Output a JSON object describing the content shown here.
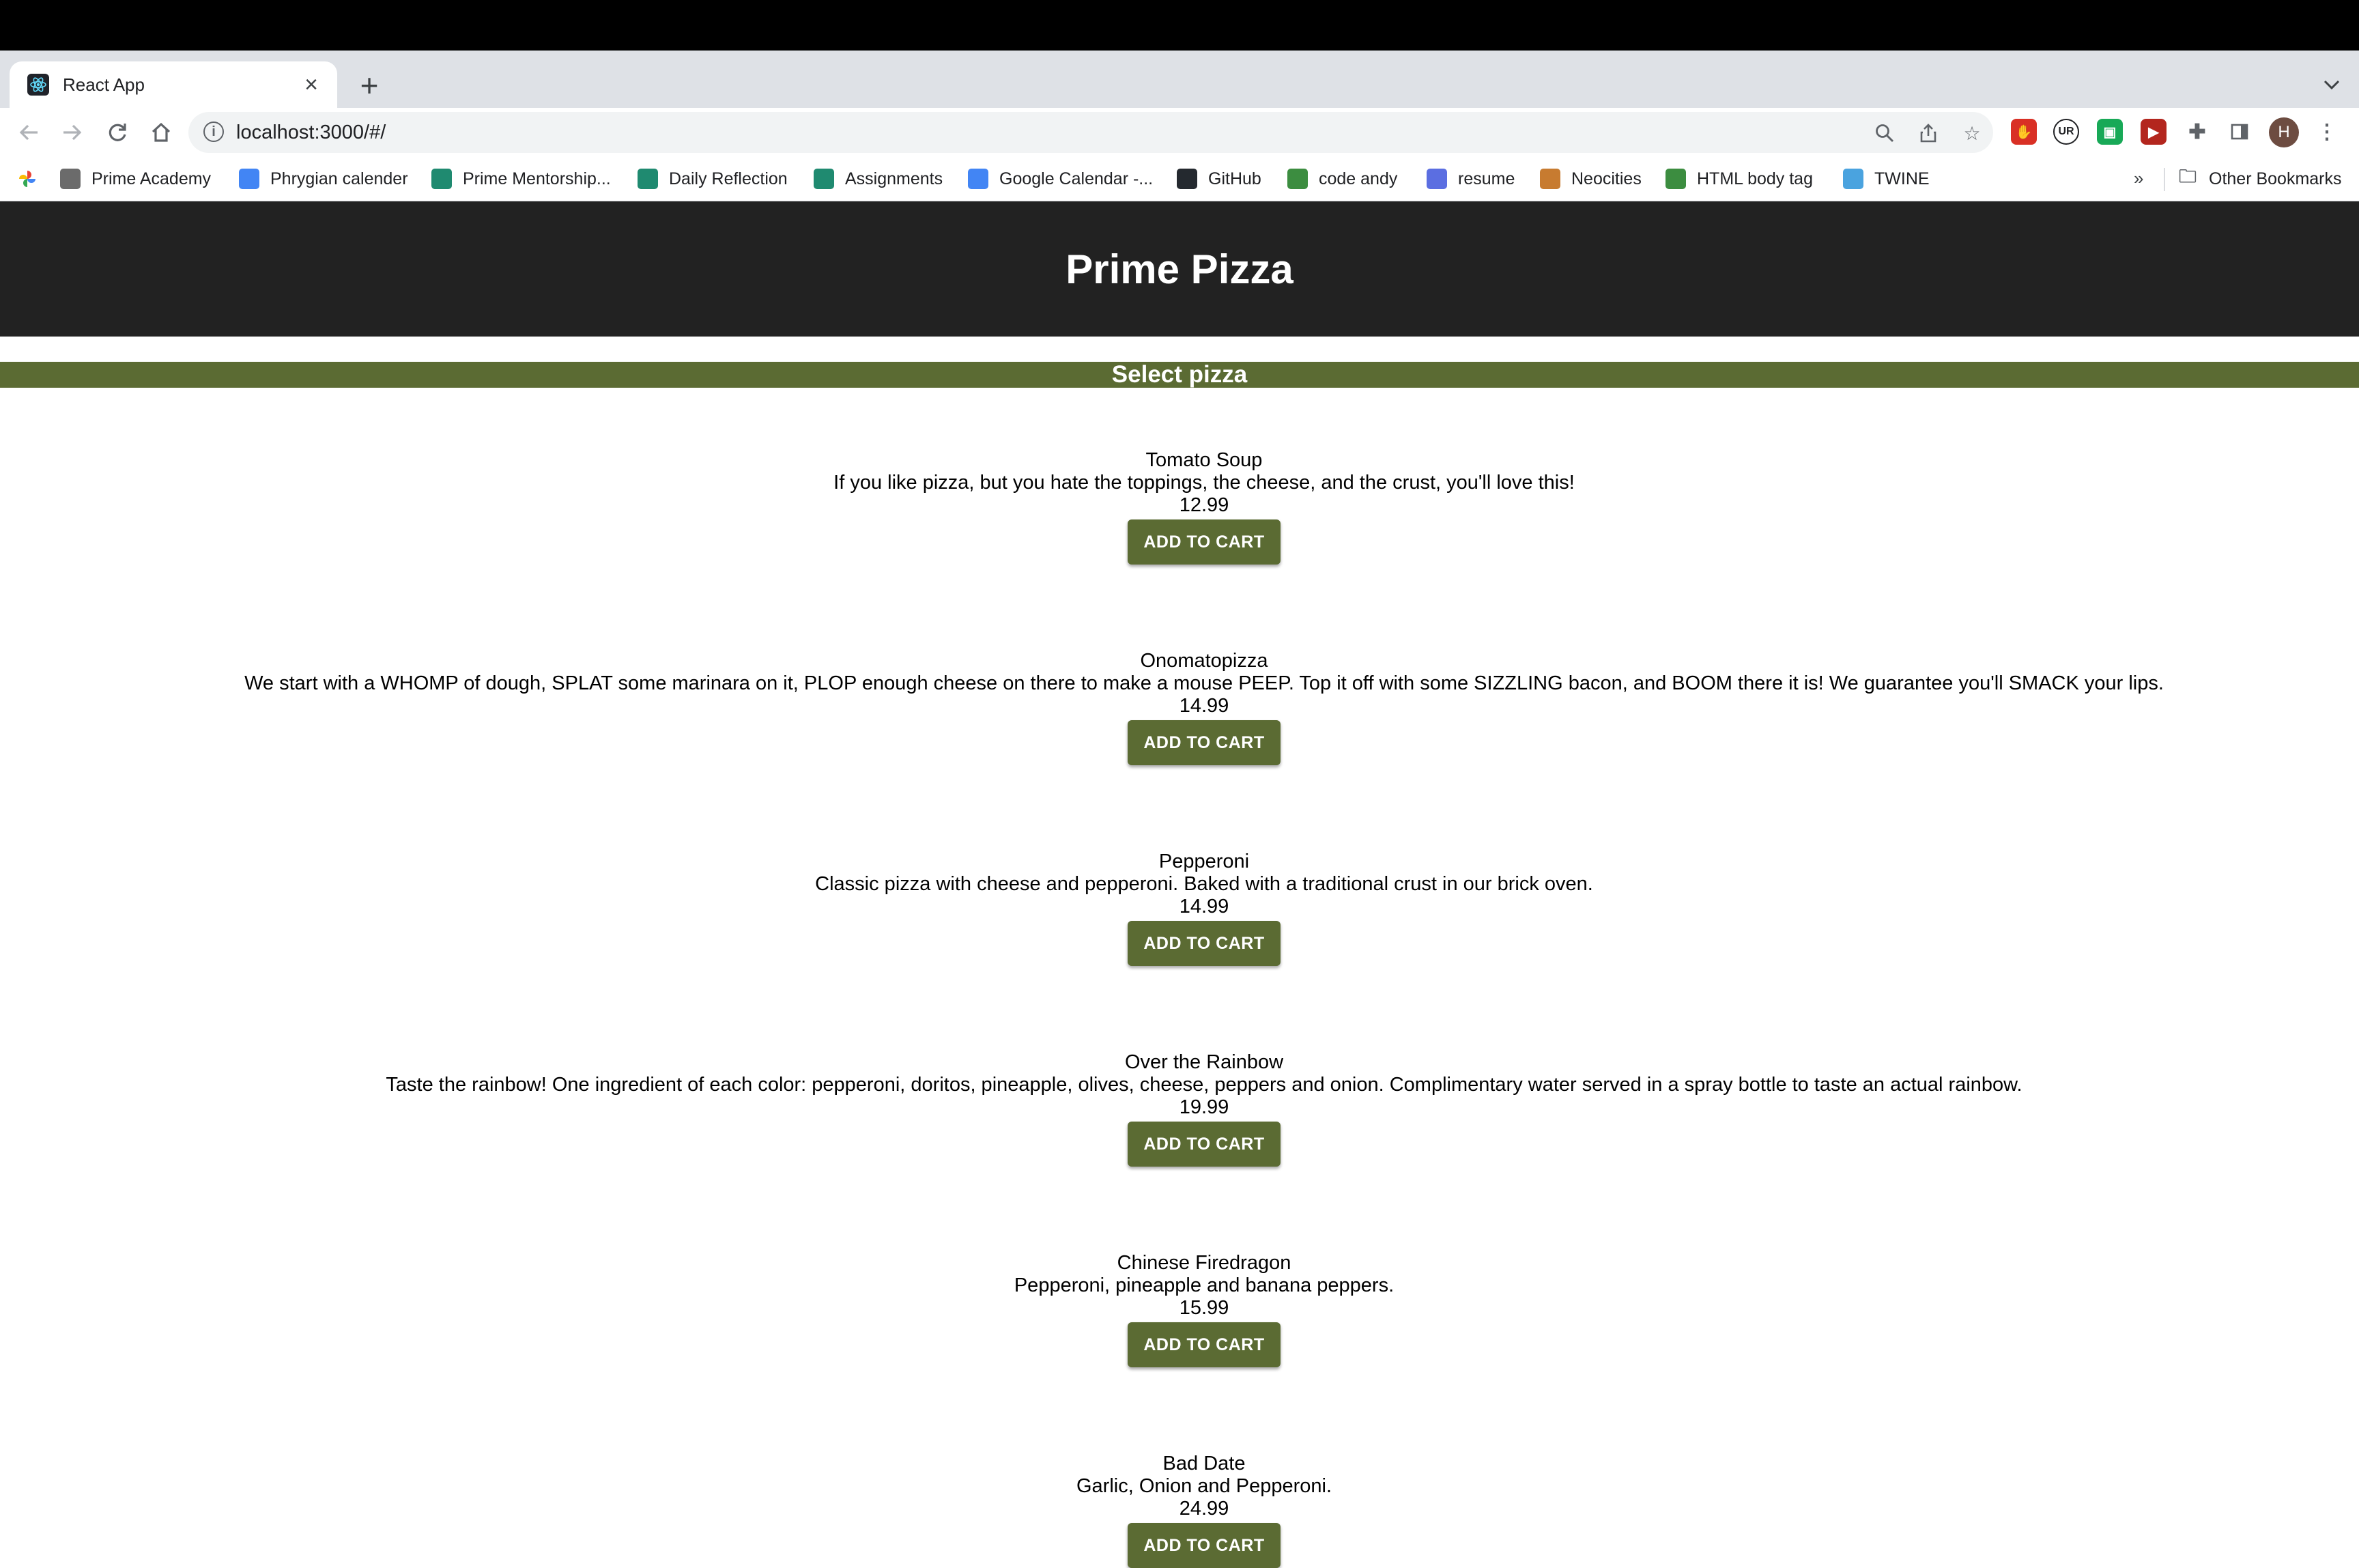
{
  "browser": {
    "tab_title": "React App",
    "url": "localhost:3000/#/",
    "bookmarks": [
      {
        "label": "Prime Academy",
        "icon": "photo-icon",
        "color": "#6b6b6b"
      },
      {
        "label": "Phrygian calender",
        "icon": "calendar-icon",
        "color": "#4285f4"
      },
      {
        "label": "Prime Mentorship...",
        "icon": "document-icon",
        "color": "#1f8a70"
      },
      {
        "label": "Daily Reflection",
        "icon": "document-icon",
        "color": "#1f8a70"
      },
      {
        "label": "Assignments",
        "icon": "document-icon",
        "color": "#1f8a70"
      },
      {
        "label": "Google Calendar -...",
        "icon": "calendar-icon",
        "color": "#4285f4"
      },
      {
        "label": "GitHub",
        "icon": "github-icon",
        "color": "#24292f"
      },
      {
        "label": "code andy",
        "icon": "w-icon",
        "color": "#3c8d40"
      },
      {
        "label": "resume",
        "icon": "globe-icon",
        "color": "#5b6ee1"
      },
      {
        "label": "Neocities",
        "icon": "cat-icon",
        "color": "#c77b30"
      },
      {
        "label": "HTML body tag",
        "icon": "w-icon",
        "color": "#3c8d40"
      },
      {
        "label": "TWINE",
        "icon": "flag-icon",
        "color": "#4aa3df"
      }
    ],
    "bookmarks_more": "»",
    "other_bookmarks": "Other Bookmarks",
    "avatar_initial": "H"
  },
  "header": {
    "title": "Prime Pizza"
  },
  "section": {
    "title": "Select pizza"
  },
  "add_to_cart_label": "ADD TO CART",
  "pizzas": [
    {
      "name": "Tomato Soup",
      "description": "If you like pizza, but you hate the toppings, the cheese, and the crust, you'll love this!",
      "price": "12.99"
    },
    {
      "name": "Onomatopizza",
      "description": "We start with a WHOMP of dough, SPLAT some marinara on it, PLOP enough cheese on there to make a mouse PEEP. Top it off with some SIZZLING bacon, and BOOM there it is! We guarantee you'll SMACK your lips.",
      "price": "14.99"
    },
    {
      "name": "Pepperoni",
      "description": "Classic pizza with cheese and pepperoni. Baked with a traditional crust in our brick oven.",
      "price": "14.99"
    },
    {
      "name": "Over the Rainbow",
      "description": "Taste the rainbow! One ingredient of each color: pepperoni, doritos, pineapple, olives, cheese, peppers and onion. Complimentary water served in a spray bottle to taste an actual rainbow.",
      "price": "19.99"
    },
    {
      "name": "Chinese Firedragon",
      "description": "Pepperoni, pineapple and banana peppers.",
      "price": "15.99"
    },
    {
      "name": "Bad Date",
      "description": "Garlic, Onion and Pepperoni.",
      "price": "24.99"
    }
  ],
  "colors": {
    "header_bg": "#222222",
    "accent": "#5b6b33"
  }
}
